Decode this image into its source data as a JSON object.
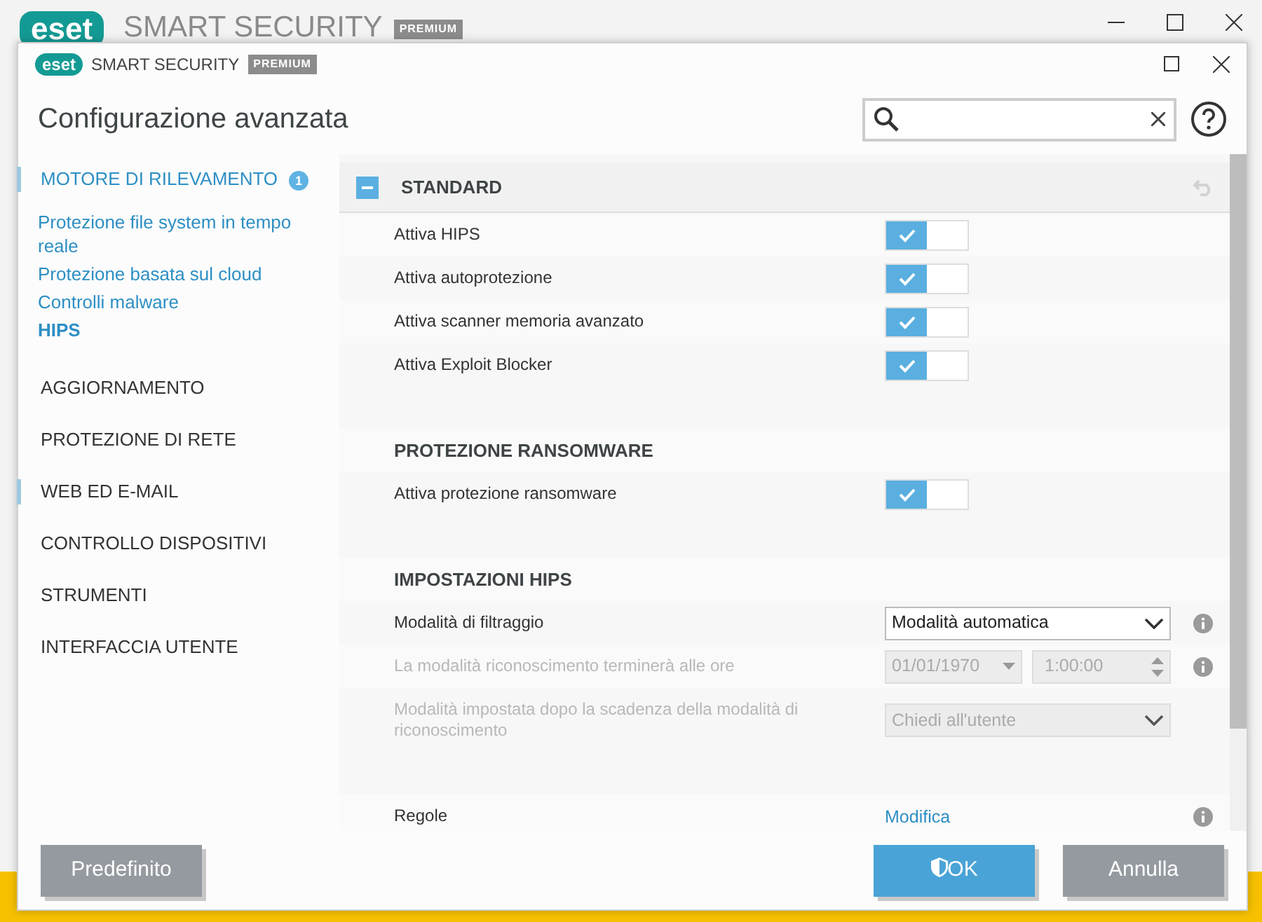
{
  "background_window": {
    "logo": "eset",
    "title": "SMART SECURITY",
    "edition": "PREMIUM"
  },
  "dialog": {
    "logo": "eset",
    "title": "SMART SECURITY",
    "edition": "PREMIUM"
  },
  "header": {
    "title": "Configurazione avanzata"
  },
  "sidebar": {
    "items": [
      {
        "label": "MOTORE DI RILEVAMENTO",
        "expanded": true,
        "marked": true,
        "badge": "1",
        "children": [
          {
            "label": "Protezione file system in tempo reale",
            "selected": false
          },
          {
            "label": "Protezione basata sul cloud",
            "selected": false
          },
          {
            "label": "Controlli malware",
            "selected": false
          },
          {
            "label": "HIPS",
            "selected": true
          }
        ]
      },
      {
        "label": "AGGIORNAMENTO",
        "expanded": false,
        "marked": false
      },
      {
        "label": "PROTEZIONE DI RETE",
        "expanded": false,
        "marked": false
      },
      {
        "label": "WEB ED E-MAIL",
        "expanded": false,
        "marked": true
      },
      {
        "label": "CONTROLLO DISPOSITIVI",
        "expanded": false,
        "marked": false
      },
      {
        "label": "STRUMENTI",
        "expanded": false,
        "marked": false
      },
      {
        "label": "INTERFACCIA UTENTE",
        "expanded": false,
        "marked": false
      }
    ]
  },
  "sections": [
    {
      "title": "STANDARD",
      "kind": "main",
      "expanded": true,
      "rows": [
        {
          "kind": "toggle",
          "label": "Attiva HIPS",
          "on": true,
          "disabled": false
        },
        {
          "kind": "toggle",
          "label": "Attiva autoprotezione",
          "on": true,
          "disabled": false
        },
        {
          "kind": "toggle",
          "label": "Attiva scanner memoria avanzato",
          "on": true,
          "disabled": false
        },
        {
          "kind": "toggle",
          "label": "Attiva Exploit Blocker",
          "on": true,
          "disabled": false
        }
      ]
    },
    {
      "title": "PROTEZIONE RANSOMWARE",
      "kind": "sub",
      "rows": [
        {
          "kind": "toggle",
          "label": "Attiva protezione ransomware",
          "on": true,
          "disabled": false
        }
      ]
    },
    {
      "title": "IMPOSTAZIONI HIPS",
      "kind": "sub",
      "rows": [
        {
          "kind": "select",
          "label": "Modalità di filtraggio",
          "value": "Modalità automatica",
          "disabled": false,
          "info": true
        },
        {
          "kind": "datetime",
          "label": "La modalità riconoscimento terminerà alle ore",
          "date": "01/01/1970",
          "time": "1:00:00",
          "disabled": true,
          "info": true
        },
        {
          "kind": "select",
          "label": "Modalità impostata dopo la scadenza della modalità di riconoscimento",
          "value": "Chiedi all'utente",
          "disabled": true,
          "info": false
        },
        {
          "kind": "link",
          "label": "Regole",
          "value": "Modifica",
          "disabled": false,
          "info": true,
          "gap_before": true
        }
      ]
    }
  ],
  "buttons": [
    {
      "label": "Predefinito",
      "kind": "secondary"
    },
    {
      "label": "OK",
      "kind": "primary"
    },
    {
      "label": "Annulla",
      "kind": "secondary"
    }
  ]
}
